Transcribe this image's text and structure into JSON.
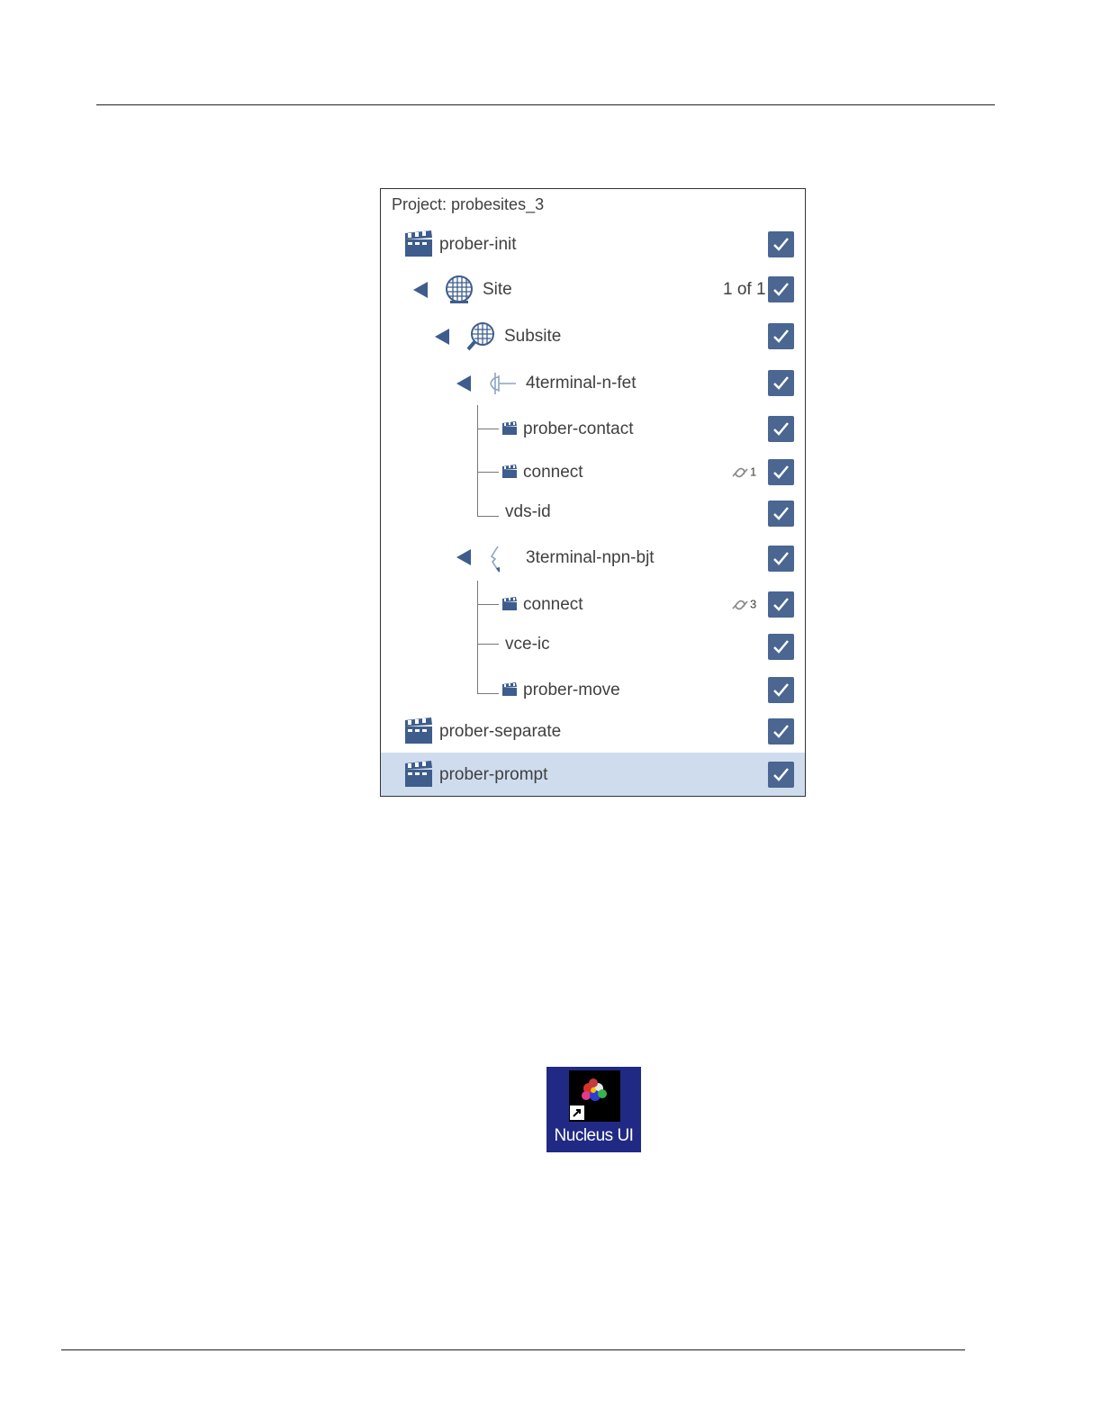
{
  "project_title": "Project: probesites_3",
  "tree": {
    "prober_init": "prober-init",
    "site": "Site",
    "site_count": "1 of 1",
    "subsite": "Subsite",
    "device1": "4terminal-n-fet",
    "d1_prober_contact": "prober-contact",
    "d1_connect": "connect",
    "d1_connect_links": "1",
    "d1_vds_id": "vds-id",
    "device2": "3terminal-npn-bjt",
    "d2_connect": "connect",
    "d2_connect_links": "3",
    "d2_vce_ic": "vce-ic",
    "d2_prober_move": "prober-move",
    "prober_separate": "prober-separate",
    "prober_prompt": "prober-prompt"
  },
  "desktop_icon": {
    "label": "Nucleus UI"
  },
  "colors": {
    "checkbox": "#4a6691",
    "selected_row": "#cfdcee",
    "icon_blue": "#3e5d8c",
    "desktop_bg": "#202a84"
  }
}
